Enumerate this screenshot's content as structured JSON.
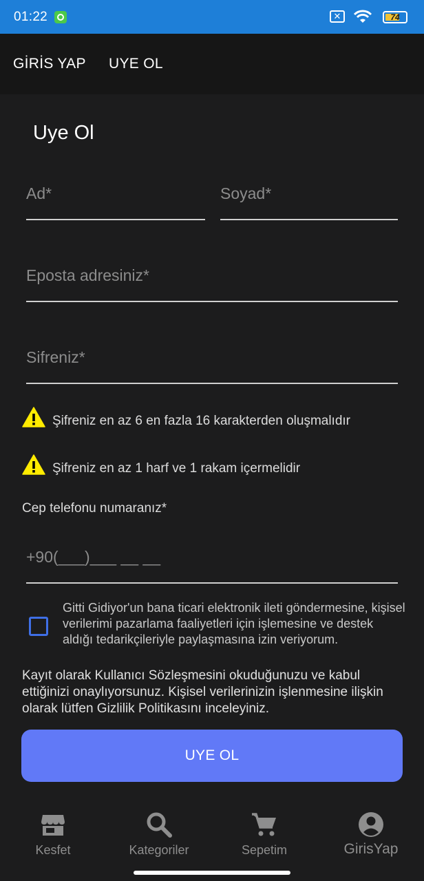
{
  "status_bar": {
    "time": "01:22",
    "battery": "74",
    "battery_level": 0.74
  },
  "tabs": {
    "login": "GİRİS YAP",
    "signup": "UYE OL"
  },
  "form": {
    "title": "Uye Ol",
    "name_placeholder": "Ad*",
    "surname_placeholder": "Soyad*",
    "email_placeholder": "Eposta adresiniz*",
    "password_placeholder": "Sifreniz*",
    "warning_1": "Şifreniz en az 6 en fazla 16 karakterden oluşmalıdır",
    "warning_2": "Şifreniz en az 1 harf ve 1 rakam içermelidir",
    "phone_label": "Cep telefonu numaranız*",
    "phone_placeholder": "+90(___)___ __ __",
    "consent_text": "Gitti Gidiyor'un bana ticari elektronik ileti göndermesine, kişisel verilerimi pazarlama faaliyetleri için işlemesine ve destek aldığı tedarikçileriyle paylaşmasına izin veriyorum.",
    "consent_checked": false,
    "legal_text": "Kayıt olarak Kullanıcı Sözleşmesini okuduğunuzu ve kabul ettiğinizi onaylıyorsunuz. Kişisel verilerinizin işlenmesine ilişkin olarak lütfen Gizlilik Politikasını inceleyiniz.",
    "submit_label": "UYE OL"
  },
  "bottom_nav": [
    {
      "label": "Kesfet",
      "icon": "store-icon"
    },
    {
      "label": "Kategoriler",
      "icon": "search-icon"
    },
    {
      "label": "Sepetim",
      "icon": "cart-icon"
    },
    {
      "label": "GirisYap",
      "icon": "account-icon"
    }
  ],
  "colors": {
    "status_bar": "#1e7fd8",
    "background": "#1c1c1d",
    "button": "#6179f7",
    "checkbox": "#3f6fe6",
    "warning": "#ffeb00"
  }
}
